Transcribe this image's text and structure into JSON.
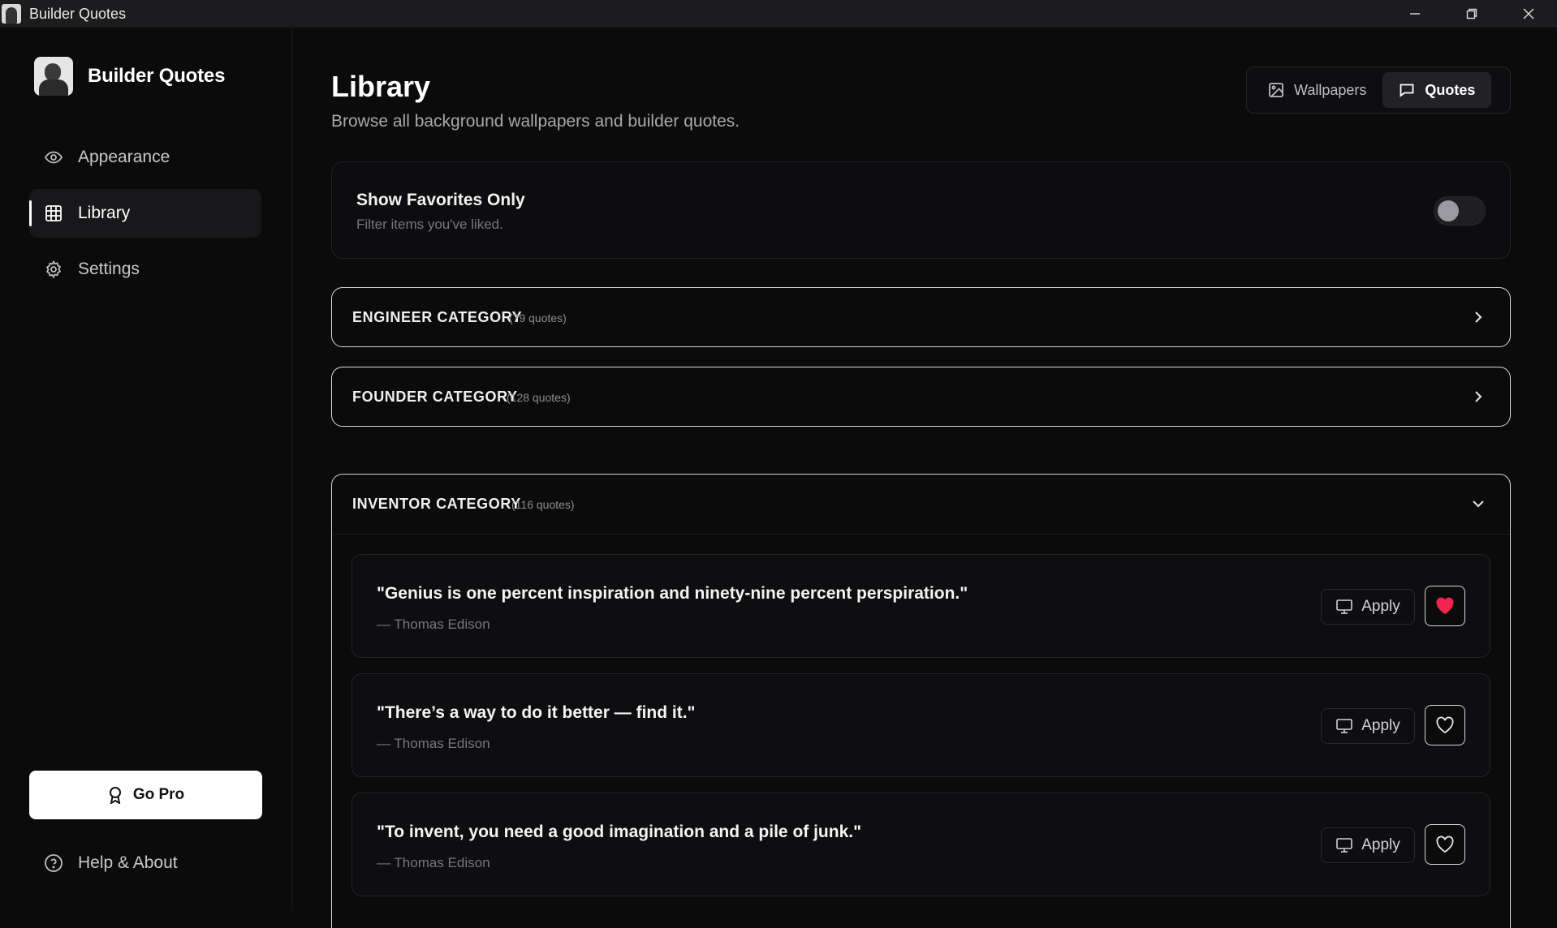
{
  "window": {
    "title": "Builder Quotes"
  },
  "sidebar": {
    "brand": "Builder Quotes",
    "items": [
      {
        "label": "Appearance",
        "icon": "eye-icon"
      },
      {
        "label": "Library",
        "icon": "grid-icon",
        "active": true
      },
      {
        "label": "Settings",
        "icon": "gear-icon"
      }
    ],
    "go_pro": "Go Pro",
    "help": "Help & About"
  },
  "main": {
    "title": "Library",
    "subtitle": "Browse all background wallpapers and builder quotes.",
    "tabs": [
      {
        "label": "Wallpapers",
        "icon": "image-icon"
      },
      {
        "label": "Quotes",
        "icon": "message-icon",
        "active": true
      }
    ],
    "favorites": {
      "title": "Show Favorites Only",
      "subtitle": "Filter items you've liked.",
      "enabled": false
    },
    "categories": [
      {
        "name": "ENGINEER CATEGORY",
        "count": "(79 quotes)",
        "expanded": false
      },
      {
        "name": "FOUNDER CATEGORY",
        "count": "(128 quotes)",
        "expanded": false
      },
      {
        "name": "INVENTOR CATEGORY",
        "count": "(116 quotes)",
        "expanded": true
      }
    ],
    "quotes": [
      {
        "text": "\"Genius is one percent inspiration and ninety-nine percent perspiration.\"",
        "author": "— Thomas Edison",
        "apply": "Apply",
        "liked": true
      },
      {
        "text": "\"There’s a way to do it better — find it.\"",
        "author": "— Thomas Edison",
        "apply": "Apply",
        "liked": false
      },
      {
        "text": "\"To invent, you need a good imagination and a pile of junk.\"",
        "author": "— Thomas Edison",
        "apply": "Apply",
        "liked": false
      }
    ]
  },
  "colors": {
    "background": "#0b0b0c",
    "accent": "#ffffff",
    "heart": "#f0244e"
  }
}
